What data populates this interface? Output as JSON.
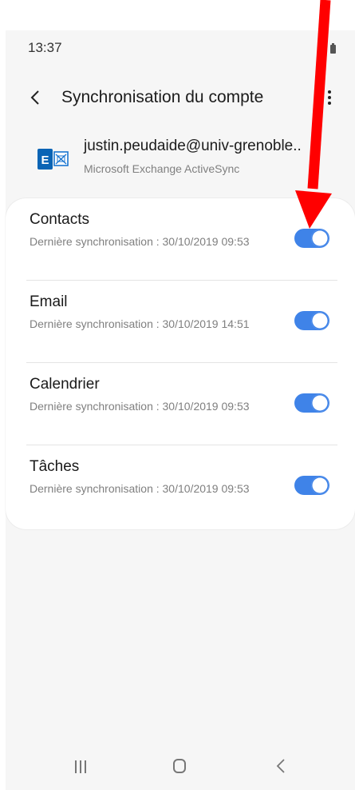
{
  "status_bar": {
    "time": "13:37"
  },
  "app_bar": {
    "title": "Synchronisation du compte"
  },
  "account": {
    "email": "justin.peudaide@univ-grenoble..",
    "type": "Microsoft Exchange ActiveSync"
  },
  "sync_items": [
    {
      "title": "Contacts",
      "subtitle": "Dernière synchronisation : 30/10/2019 09:53",
      "enabled": true
    },
    {
      "title": "Email",
      "subtitle": "Dernière synchronisation : 30/10/2019 14:51",
      "enabled": true
    },
    {
      "title": "Calendrier",
      "subtitle": "Dernière synchronisation : 30/10/2019 09:53",
      "enabled": true
    },
    {
      "title": "Tâches",
      "subtitle": "Dernière synchronisation : 30/10/2019 09:53",
      "enabled": true
    }
  ],
  "colors": {
    "toggle_on": "#3f83e8",
    "annotation_arrow": "#ff0000",
    "background": "#f6f6f6"
  },
  "icons": {
    "back": "chevron-left-icon",
    "more": "more-vertical-icon",
    "account": "exchange-icon",
    "nav_recents": "recents-icon",
    "nav_home": "home-icon",
    "nav_back": "back-icon"
  }
}
